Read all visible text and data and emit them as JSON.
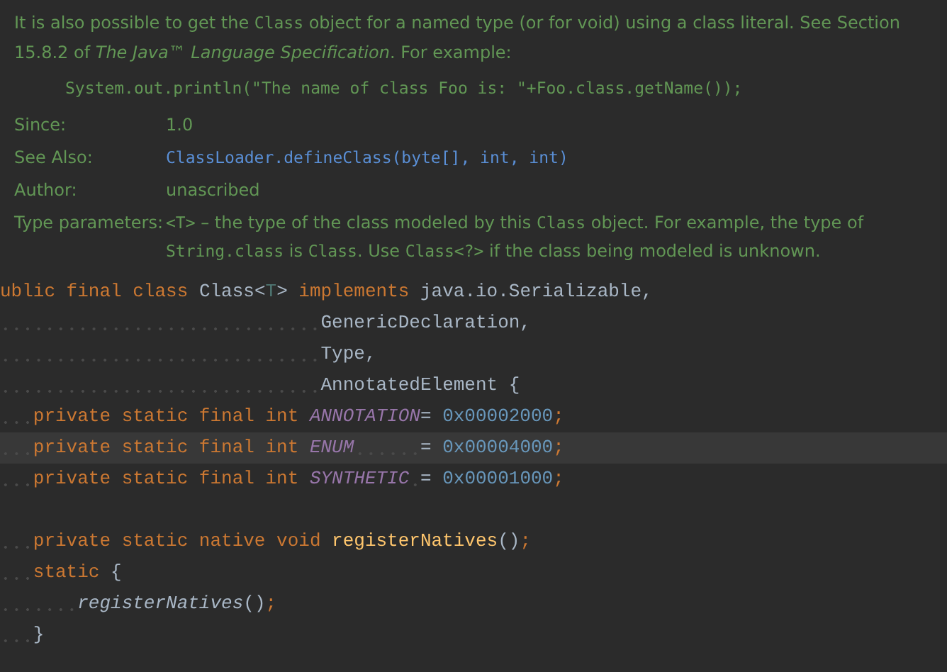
{
  "doc": {
    "paragraph": [
      {
        "kind": "text",
        "text": "It is also possible to get the "
      },
      {
        "kind": "code",
        "text": "Class"
      },
      {
        "kind": "text",
        "text": " object for a named type (or for void) using a class literal. See Section 15.8.2 of "
      },
      {
        "kind": "italic",
        "text": "The Java™ Language Specification"
      },
      {
        "kind": "text",
        "text": ". For example:"
      }
    ],
    "example": "System.out.println(\"The name of class Foo is: \"+Foo.class.getName());",
    "tags": [
      {
        "label": "Since:",
        "value": [
          {
            "kind": "text",
            "text": "1.0"
          }
        ]
      },
      {
        "label": "See Also:",
        "value": [
          {
            "kind": "link",
            "text": "ClassLoader.defineClass(byte[], int, int)"
          }
        ]
      },
      {
        "label": "Author:",
        "value": [
          {
            "kind": "text",
            "text": "unascribed"
          }
        ]
      },
      {
        "label": "Type parameters:",
        "value": [
          {
            "kind": "code",
            "text": "<T>"
          },
          {
            "kind": "text",
            "text": " – the type of the class modeled by this "
          },
          {
            "kind": "code",
            "text": "Class"
          },
          {
            "kind": "text",
            "text": " object. For example, the type of "
          },
          {
            "kind": "code",
            "text": "String.class"
          },
          {
            "kind": "text",
            "text": " is "
          },
          {
            "kind": "code",
            "text": "Class"
          },
          {
            "kind": "text",
            "text": ". Use "
          },
          {
            "kind": "code",
            "text": "Class<?>"
          },
          {
            "kind": "text",
            "text": " if the class being modeled is unknown."
          }
        ]
      }
    ]
  },
  "code": {
    "lines": [
      {
        "current": false,
        "tokens": [
          {
            "kind": "keyword",
            "text": "ublic final class "
          },
          {
            "kind": "plain",
            "text": "Class<"
          },
          {
            "kind": "typeparam",
            "text": "T"
          },
          {
            "kind": "plain",
            "text": "> "
          },
          {
            "kind": "keyword",
            "text": "implements "
          },
          {
            "kind": "plain",
            "text": "java.io.Serializable,"
          }
        ]
      },
      {
        "current": false,
        "tokens": [
          {
            "kind": "plain",
            "text": "                             GenericDeclaration,"
          }
        ]
      },
      {
        "current": false,
        "tokens": [
          {
            "kind": "plain",
            "text": "                             Type,"
          }
        ]
      },
      {
        "current": false,
        "tokens": [
          {
            "kind": "plain",
            "text": "                             AnnotatedElement {"
          }
        ]
      },
      {
        "current": false,
        "tokens": [
          {
            "kind": "keyword",
            "text": "   private static final int "
          },
          {
            "kind": "constant",
            "text": "ANNOTATION"
          },
          {
            "kind": "plain",
            "text": "= "
          },
          {
            "kind": "number",
            "text": "0x00002000"
          },
          {
            "kind": "keyword",
            "text": ";"
          }
        ]
      },
      {
        "current": true,
        "tokens": [
          {
            "kind": "keyword",
            "text": "   private static final int "
          },
          {
            "kind": "constant",
            "text": "ENUM"
          },
          {
            "kind": "plain",
            "text": "      = "
          },
          {
            "kind": "number",
            "text": "0x00004000"
          },
          {
            "kind": "keyword",
            "text": ";"
          }
        ]
      },
      {
        "current": false,
        "tokens": [
          {
            "kind": "keyword",
            "text": "   private static final int "
          },
          {
            "kind": "constant",
            "text": "SYNTHETIC"
          },
          {
            "kind": "plain",
            "text": " = "
          },
          {
            "kind": "number",
            "text": "0x00001000"
          },
          {
            "kind": "keyword",
            "text": ";"
          }
        ]
      },
      {
        "current": false
      },
      {
        "current": false,
        "tokens": [
          {
            "kind": "keyword",
            "text": "   private static native void "
          },
          {
            "kind": "method",
            "text": "registerNatives"
          },
          {
            "kind": "plain",
            "text": "()"
          },
          {
            "kind": "keyword",
            "text": ";"
          }
        ]
      },
      {
        "current": false,
        "tokens": [
          {
            "kind": "keyword",
            "text": "   static "
          },
          {
            "kind": "plain",
            "text": "{"
          }
        ]
      },
      {
        "current": false,
        "tokens": [
          {
            "kind": "call",
            "text": "       registerNatives"
          },
          {
            "kind": "plain",
            "text": "()"
          },
          {
            "kind": "keyword",
            "text": ";"
          }
        ]
      },
      {
        "current": false,
        "tokens": [
          {
            "kind": "plain",
            "text": "   }"
          }
        ]
      }
    ]
  }
}
